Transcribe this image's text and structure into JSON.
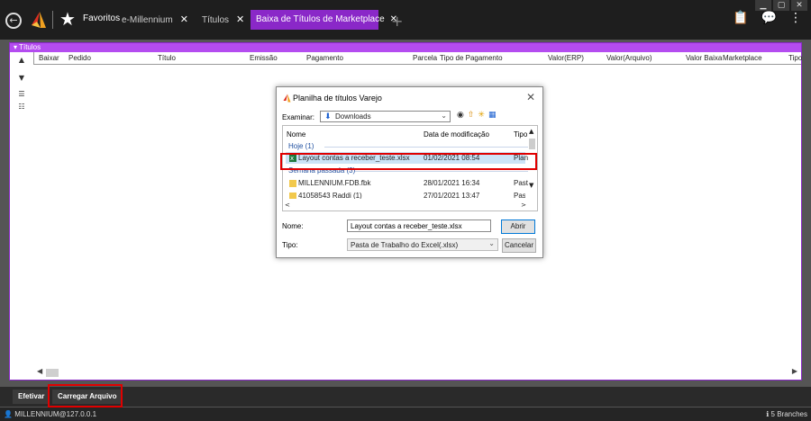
{
  "window": {
    "controls": [
      "▁",
      "▢",
      "✕"
    ],
    "colors": {
      "accent": "#8a28c8",
      "header": "#b44cf0",
      "highlight": "#e00000"
    }
  },
  "tabs": {
    "favoritos": "Favoritos",
    "items": [
      {
        "label": "e-Millennium"
      },
      {
        "label": "Títulos"
      }
    ],
    "active": "Baixa de Títulos de Marketplace"
  },
  "panel": {
    "title": "Títulos",
    "columns": [
      "Baixar",
      "Pedido",
      "Título",
      "Emissão",
      "Pagamento",
      "Parcela",
      "Tipo de Pagamento",
      "Valor(ERP)",
      "Valor(Arquivo)",
      "Valor Baixa",
      "Marketplace",
      "Tipo"
    ]
  },
  "bottom": {
    "efetivar": "Efetivar",
    "carregar": "Carregar Arquivo",
    "user": "MILLENNIUM@127.0.0.1",
    "branches": "5 Branches"
  },
  "dialog": {
    "title": "Planilha de títulos Varejo",
    "look_in_label": "Examinar:",
    "look_in_value": "Downloads",
    "headers": {
      "name": "Nome",
      "date": "Data de modificação",
      "type": "Tipo"
    },
    "groups": [
      "Hoje (1)",
      "Semana passada (3)"
    ],
    "files": [
      {
        "name": "Layout contas a receber_teste.xlsx",
        "date": "01/02/2021 08:54",
        "type": "Plan"
      },
      {
        "name": "MILLENNIUM.FDB.fbk",
        "date": "28/01/2021 16:34",
        "type": "Past"
      },
      {
        "name": "41058543 Raddi (1)",
        "date": "27/01/2021 13:47",
        "type": "Past"
      }
    ],
    "name_label": "Nome:",
    "name_value": "Layout contas a receber_teste.xlsx",
    "type_label": "Tipo:",
    "type_value": "Pasta de Trabalho do Excel(.xlsx)",
    "open_button": "Abrir",
    "cancel_button": "Cancelar"
  }
}
